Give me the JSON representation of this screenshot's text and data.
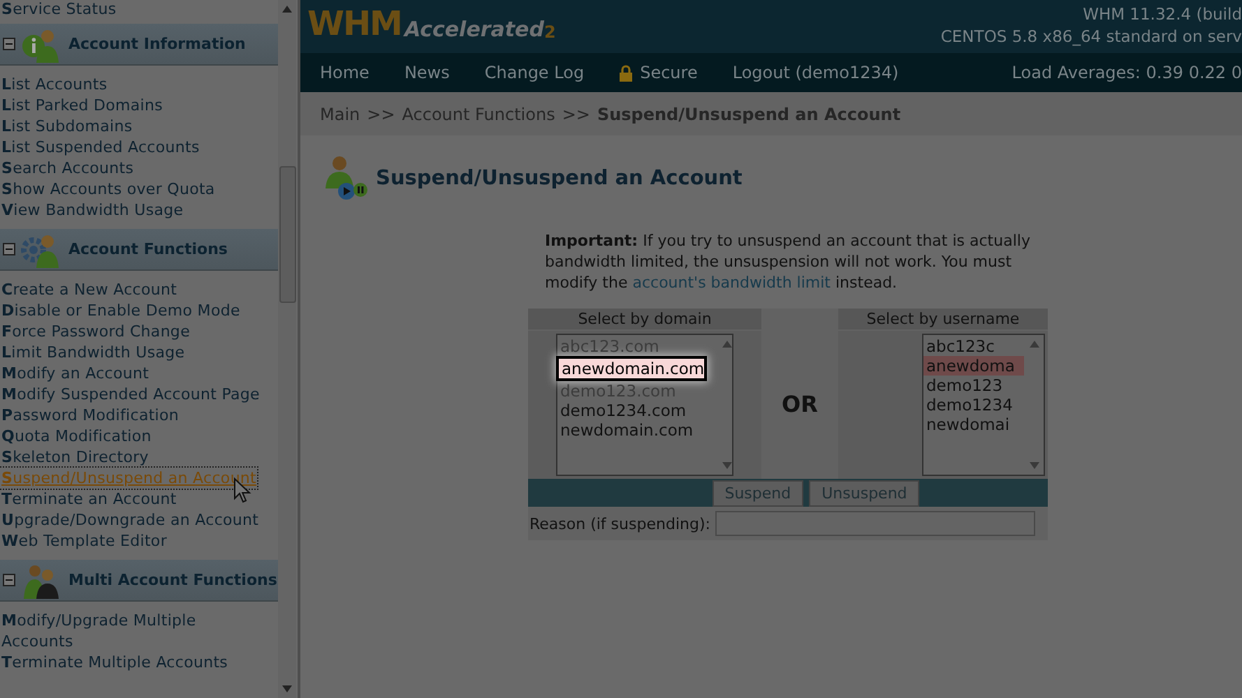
{
  "sidebar": {
    "top_item": "Service Status",
    "sections": [
      {
        "title": "Account Information",
        "expanded": true,
        "items": [
          {
            "label": "List Accounts",
            "selected": false
          },
          {
            "label": "List Parked Domains",
            "selected": false
          },
          {
            "label": "List Subdomains",
            "selected": false
          },
          {
            "label": "List Suspended Accounts",
            "selected": false
          },
          {
            "label": "Search Accounts",
            "selected": false
          },
          {
            "label": "Show Accounts over Quota",
            "selected": false
          },
          {
            "label": "View Bandwidth Usage",
            "selected": false
          }
        ]
      },
      {
        "title": "Account Functions",
        "expanded": true,
        "items": [
          {
            "label": "Create a New Account",
            "selected": false
          },
          {
            "label": "Disable or Enable Demo Mode",
            "selected": false
          },
          {
            "label": "Force Password Change",
            "selected": false
          },
          {
            "label": "Limit Bandwidth Usage",
            "selected": false
          },
          {
            "label": "Modify an Account",
            "selected": false
          },
          {
            "label": "Modify Suspended Account Page",
            "selected": false
          },
          {
            "label": "Password Modification",
            "selected": false
          },
          {
            "label": "Quota Modification",
            "selected": false
          },
          {
            "label": "Skeleton Directory",
            "selected": false
          },
          {
            "label": "Suspend/Unsuspend an Account",
            "selected": true
          },
          {
            "label": "Terminate an Account",
            "selected": false
          },
          {
            "label": "Upgrade/Downgrade an Account",
            "selected": false
          },
          {
            "label": "Web Template Editor",
            "selected": false
          }
        ]
      },
      {
        "title": "Multi Account Functions",
        "expanded": true,
        "items": [
          {
            "label": "Modify/Upgrade Multiple Accounts",
            "selected": false
          },
          {
            "label": "Terminate Multiple Accounts",
            "selected": false
          }
        ]
      }
    ]
  },
  "header": {
    "logo": "WHM",
    "logo_sub": "Accelerated",
    "logo_version": "2",
    "version": "WHM 11.32.4 (build",
    "os": "CENTOS 5.8 x86_64 standard on serv"
  },
  "nav": {
    "items": [
      {
        "label": "Home",
        "kind": "link"
      },
      {
        "label": "News",
        "kind": "link"
      },
      {
        "label": "Change Log",
        "kind": "link"
      },
      {
        "label": "Secure",
        "kind": "lock"
      },
      {
        "label": "Logout (demo1234)",
        "kind": "link"
      }
    ],
    "load": "Load Averages: 0.39 0.22 0"
  },
  "breadcrumb": {
    "parts": [
      "Main",
      ">>",
      "Account Functions",
      ">>"
    ],
    "current": "Suspend/Unsuspend an Account"
  },
  "page_title": "Suspend/Unsuspend an Account",
  "notice": {
    "before": "**Important:** If you try to unsuspend an account that is actually bandwidth limited, the unsuspension will not work. You must modify the",
    "link": "account's bandwidth limit",
    "after": "instead."
  },
  "domain_list": {
    "header": "Select by domain",
    "options": [
      {
        "label": "abc123.com",
        "selected": false,
        "suspended": true
      },
      {
        "label": "anewdomain.com",
        "selected": true,
        "suspended": false
      },
      {
        "label": "demo123.com",
        "selected": false,
        "suspended": true
      },
      {
        "label": "demo1234.com",
        "selected": false,
        "suspended": false
      },
      {
        "label": "newdomain.com",
        "selected": false,
        "suspended": false
      }
    ]
  },
  "separator": "OR",
  "user_list": {
    "header": "Select by username",
    "options": [
      {
        "label": "abc123c",
        "selected": false
      },
      {
        "label": "anewdoma",
        "selected": true
      },
      {
        "label": "demo123",
        "selected": false
      },
      {
        "label": "demo1234",
        "selected": false
      },
      {
        "label": "newdomai",
        "selected": false
      }
    ]
  },
  "buttons": [
    "Suspend",
    "Unsuspend"
  ],
  "reason": {
    "label": "Reason (if suspending):"
  }
}
